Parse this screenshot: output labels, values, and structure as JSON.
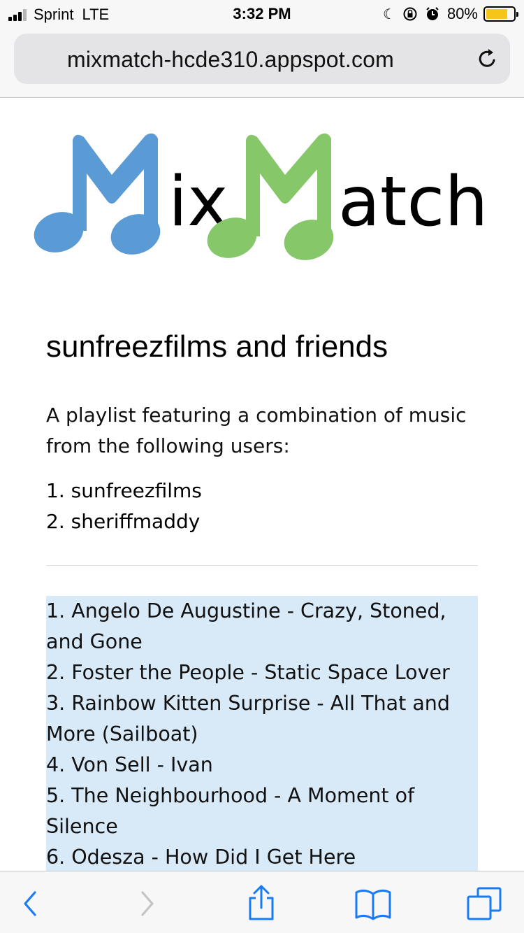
{
  "status_bar": {
    "carrier": "Sprint",
    "network": "LTE",
    "time": "3:32 PM",
    "battery": "80%",
    "battery_level": 0.8,
    "icons": [
      "moon-icon",
      "rotation-lock-icon",
      "alarm-icon"
    ]
  },
  "browser": {
    "url": "mixmatch-hcde310.appspot.com",
    "reload_icon": "reload-icon"
  },
  "logo": {
    "text_part1": "ix",
    "text_part2": "atch",
    "color_m1": "#5b9bd5",
    "color_m2": "#86c76a"
  },
  "page": {
    "title": "sunfreezfilms and friends",
    "description": "A playlist featuring a combination of music from the following users:",
    "users": [
      "1. sunfreezfilms",
      "2. sheriffmaddy"
    ],
    "playlist_bg": "#d8e9f8",
    "tracks": [
      "1. Angelo De Augustine - Crazy, Stoned, and Gone",
      "2. Foster the People - Static Space Lover",
      "3. Rainbow Kitten Surprise - All That and More (Sailboat)",
      "4. Von Sell - Ivan",
      "5. The Neighbourhood - A Moment of Silence",
      "6. Odesza - How Did I Get Here"
    ]
  },
  "toolbar": {
    "accent": "#1a7cf5",
    "buttons": [
      "back-icon",
      "forward-icon",
      "share-icon",
      "bookmarks-icon",
      "tabs-icon"
    ]
  }
}
